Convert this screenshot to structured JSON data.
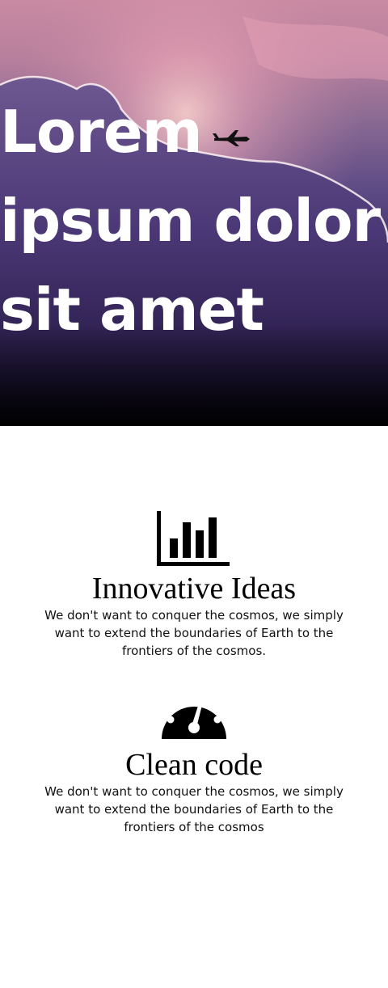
{
  "hero": {
    "title": "Lorem ipsum dolor sit amet"
  },
  "features": [
    {
      "icon": "bar-chart-icon",
      "title": "Innovative Ideas",
      "text": "We don't want to conquer the cosmos, we simply want to extend the boundaries of Earth to the frontiers of the cosmos."
    },
    {
      "icon": "speedometer-icon",
      "title": "Clean code",
      "text": "We don't want to conquer the cosmos, we simply want to extend the boundaries of Earth to the frontiers of the cosmos"
    }
  ],
  "colors": {
    "hero_top": "#c98aa2",
    "hero_bottom": "#000000",
    "text": "#ffffff"
  }
}
